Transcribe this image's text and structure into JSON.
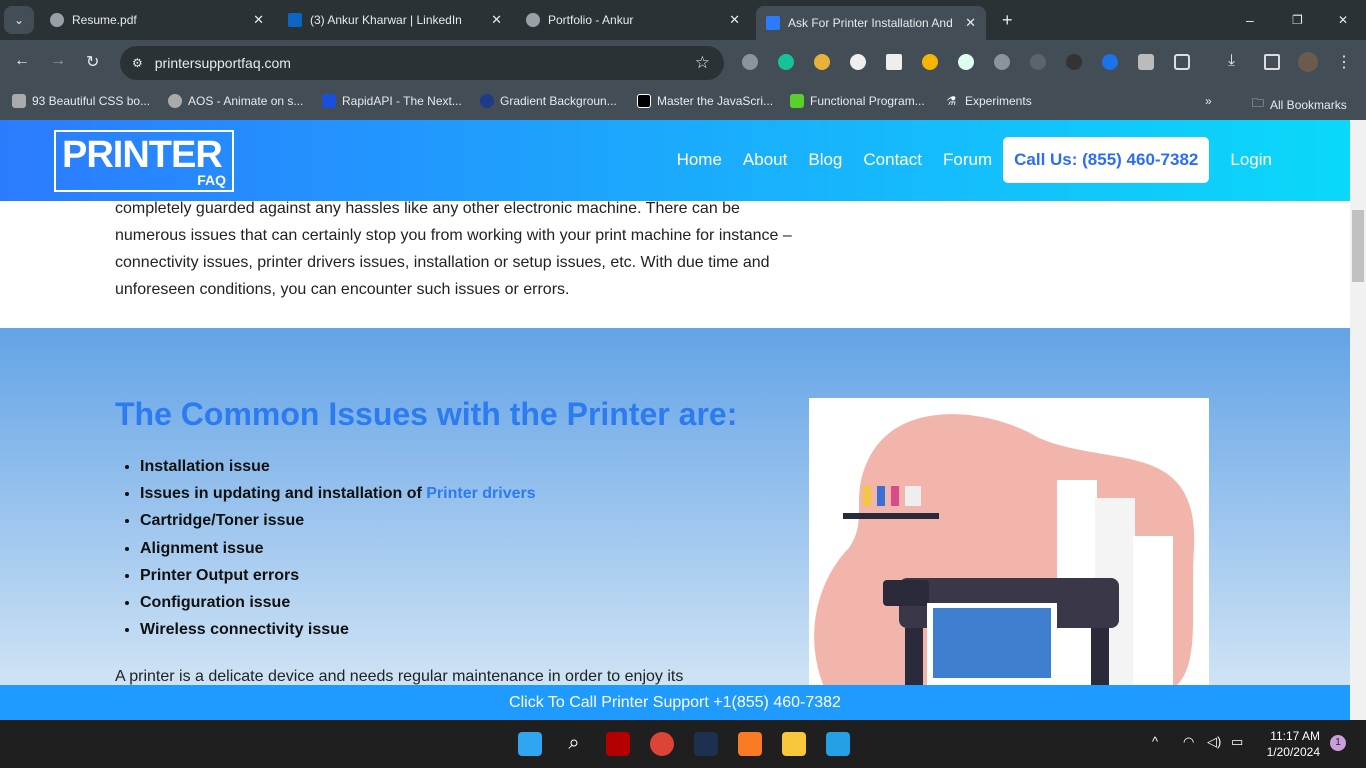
{
  "browser": {
    "tabs": [
      {
        "title": "Resume.pdf"
      },
      {
        "title": "(3) Ankur Kharwar | LinkedIn"
      },
      {
        "title": "Portfolio - Ankur"
      },
      {
        "title": "Ask For Printer Installation And",
        "active": true
      }
    ],
    "url": "printersupportfaq.com",
    "bookmarks": [
      "93 Beautiful CSS bo...",
      "AOS - Animate on s...",
      "RapidAPI - The Next...",
      "Gradient Backgroun...",
      "Master the JavaScri...",
      "Functional Program...",
      "Experiments"
    ],
    "all_bookmarks": "All Bookmarks"
  },
  "site": {
    "logo_top": "PRINTER",
    "logo_bottom": "FAQ",
    "nav": [
      "Home",
      "About",
      "Blog",
      "Contact",
      "Forum"
    ],
    "call": "Call Us: (855) 460-7382",
    "login": "Login",
    "intro": "completely guarded against any hassles like any other electronic machine. There can be numerous issues that can certainly stop you from working with your print machine for instance – connectivity issues, printer drivers issues, installation or setup issues, etc. With due time and unforeseen conditions, you can encounter such issues or errors.",
    "heading": "The Common Issues with the Printer are:",
    "issues": [
      "Installation issue",
      "Issues in updating and installation of ",
      "Cartridge/Toner issue",
      "Alignment issue",
      "Printer Output errors",
      "Configuration issue",
      "Wireless connectivity issue"
    ],
    "issue_link": "Printer drivers",
    "para2": "A printer is a delicate device and needs regular maintenance in order to enjoy its",
    "footer": "Click To Call Printer Support +1(855) 460-7382"
  },
  "taskbar": {
    "time": "11:17 AM",
    "date": "1/20/2024",
    "notifications": "1"
  }
}
